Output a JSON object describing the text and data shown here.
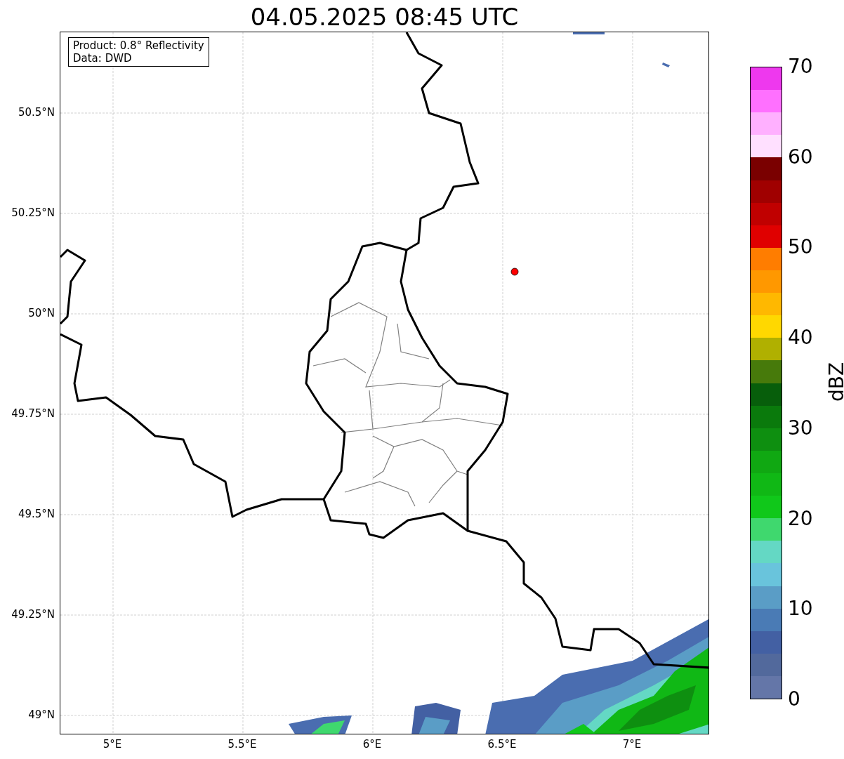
{
  "title": "04.05.2025 08:45 UTC",
  "info_box": [
    "Product: 0.8° Reflectivity",
    "Data: DWD"
  ],
  "y_ticks": [
    "50.5°N",
    "50.25°N",
    "50°N",
    "49.75°N",
    "49.5°N",
    "49.25°N",
    "49°N"
  ],
  "x_ticks": [
    "5°E",
    "5.5°E",
    "6°E",
    "6.5°E",
    "7°E"
  ],
  "colorbar": {
    "label": "dBZ",
    "ticks": [
      "70",
      "60",
      "50",
      "40",
      "30",
      "20",
      "10",
      "0"
    ],
    "bins": [
      {
        "color": "#ee38ee"
      },
      {
        "color": "#ff70ff"
      },
      {
        "color": "#ffb0ff"
      },
      {
        "color": "#ffe0ff"
      },
      {
        "color": "#7a0000"
      },
      {
        "color": "#a00000"
      },
      {
        "color": "#c00000"
      },
      {
        "color": "#e00000"
      },
      {
        "color": "#ff7d00"
      },
      {
        "color": "#ff9800"
      },
      {
        "color": "#ffb800"
      },
      {
        "color": "#ffd800"
      },
      {
        "color": "#b0b000"
      },
      {
        "color": "#477a0b"
      },
      {
        "color": "#075e0b"
      },
      {
        "color": "#0a7a0c"
      },
      {
        "color": "#0e8f10"
      },
      {
        "color": "#10a812"
      },
      {
        "color": "#10b815"
      },
      {
        "color": "#10c81a"
      },
      {
        "color": "#3fd86e"
      },
      {
        "color": "#64d8c4"
      },
      {
        "color": "#69c4dc"
      },
      {
        "color": "#5a9dc6"
      },
      {
        "color": "#4a7bb5"
      },
      {
        "color": "#4360a3"
      },
      {
        "color": "#52699c"
      },
      {
        "color": "#6476a8"
      }
    ]
  }
}
